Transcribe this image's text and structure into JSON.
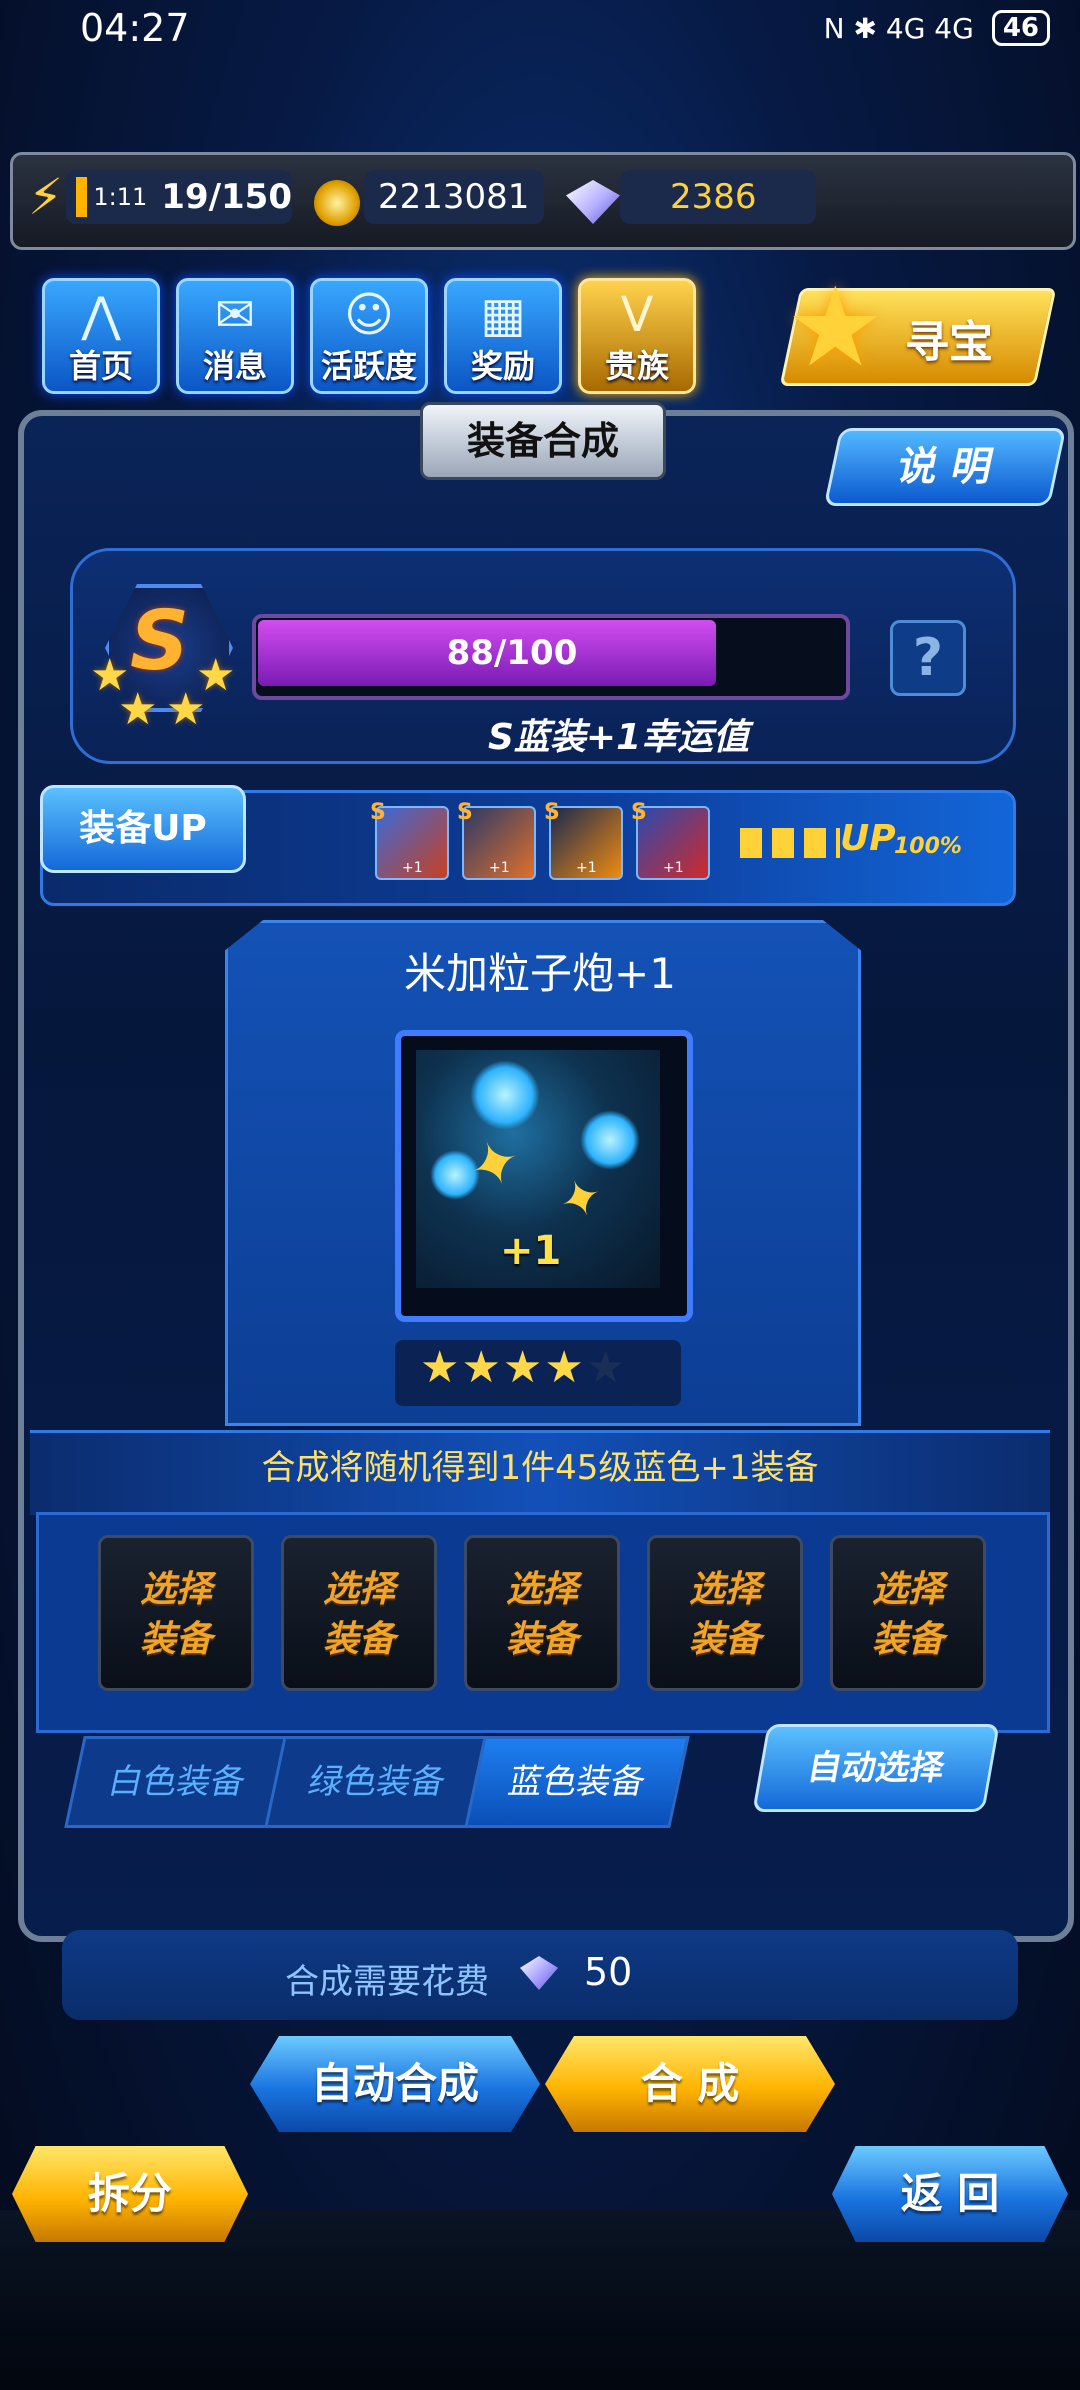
{
  "status_bar": {
    "time": "04:27",
    "icons": "N ✱ 4G 4G",
    "battery": "46"
  },
  "resources": {
    "energy_timer": "1:11",
    "energy": "19/150",
    "gold": "2213081",
    "diamonds": "2386"
  },
  "nav": [
    {
      "label": "首页",
      "icon": "home-icon"
    },
    {
      "label": "消息",
      "icon": "mail-icon"
    },
    {
      "label": "活跃度",
      "icon": "smiley-icon"
    },
    {
      "label": "奖励",
      "icon": "gift-icon"
    },
    {
      "label": "贵族",
      "icon": "noble-icon"
    }
  ],
  "treasure_label": "寻宝",
  "panel_title": "装备合成",
  "explain_label": "说 明",
  "rank": {
    "letter": "S",
    "progress": 0.88,
    "progress_text": "88/100",
    "luck_text": "S蓝装+1幸运值"
  },
  "equip_up": {
    "label": "装备UP",
    "mini_items": [
      {
        "grade": "S",
        "plus": "+1"
      },
      {
        "grade": "S",
        "plus": "+1"
      },
      {
        "grade": "S",
        "plus": "+1"
      },
      {
        "grade": "S",
        "plus": "+1"
      }
    ],
    "up_text": "UP",
    "up_percent": "100%"
  },
  "item": {
    "name": "米加粒子炮+1",
    "plus": "+1",
    "stars_filled": 4,
    "stars_total": 5
  },
  "result_text": "合成将随机得到1件45级蓝色+1装备",
  "slots": [
    {
      "line1": "选择",
      "line2": "装备"
    },
    {
      "line1": "选择",
      "line2": "装备"
    },
    {
      "line1": "选择",
      "line2": "装备"
    },
    {
      "line1": "选择",
      "line2": "装备"
    },
    {
      "line1": "选择",
      "line2": "装备"
    }
  ],
  "tabs": [
    {
      "label": "白色装备"
    },
    {
      "label": "绿色装备"
    },
    {
      "label": "蓝色装备"
    }
  ],
  "active_tab": 2,
  "auto_select_label": "自动选择",
  "cost": {
    "label": "合成需要花费",
    "value": "50"
  },
  "buttons": {
    "auto_merge": "自动合成",
    "merge": "合 成",
    "split": "拆分",
    "back": "返 回"
  },
  "colors": {
    "accent_blue": "#1469d8",
    "gold": "#ffb400",
    "rank_orange": "#ffb330",
    "progress_purple": "#b13be0"
  }
}
